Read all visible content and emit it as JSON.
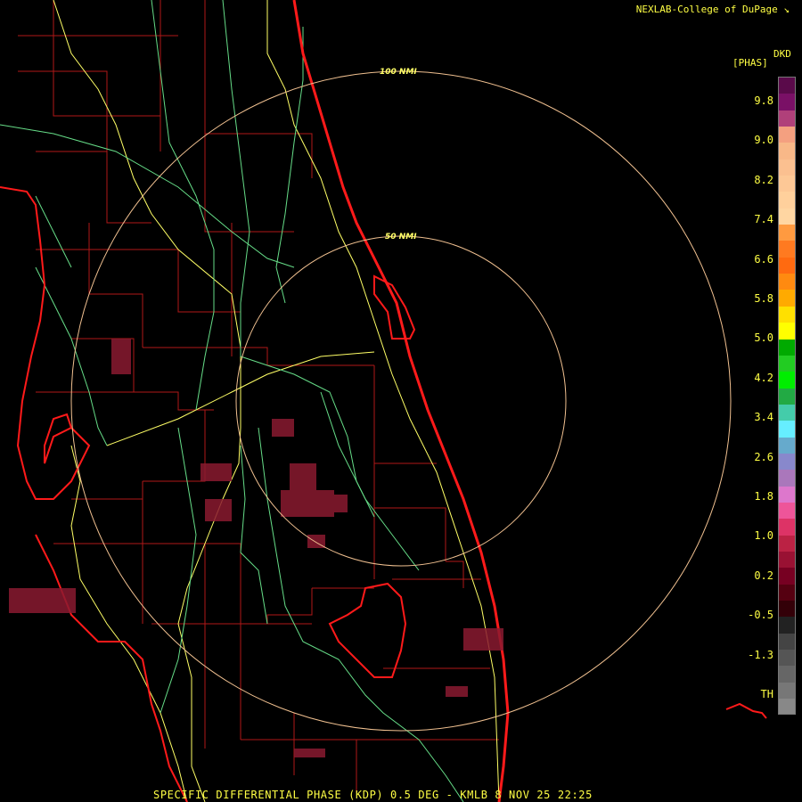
{
  "credit": "NEXLAB-College of DuPage",
  "credit_logo_icon": "nexlab-logo-icon",
  "footer": "SPECIFIC DIFFERENTIAL PHASE (KDP) 0.5 DEG - KMLB 8 NOV 25 22:25",
  "legend": {
    "unit_left": "[PHAS]",
    "unit_right": "DKD",
    "labels": [
      "9.8",
      "9.0",
      "8.2",
      "7.4",
      "6.6",
      "5.8",
      "5.0",
      "4.2",
      "3.4",
      "2.6",
      "1.8",
      "1.0",
      "0.2",
      "-0.5",
      "-1.3",
      "TH"
    ],
    "colors": [
      "#5a0a4a",
      "#7a1066",
      "#b0407a",
      "#f4a080",
      "#f8b888",
      "#fbc090",
      "#fdc896",
      "#ffd09c",
      "#ffd6a2",
      "#ff9a40",
      "#ff7a20",
      "#ff6a10",
      "#ff8a10",
      "#ffaa00",
      "#ffe000",
      "#ffff00",
      "#00aa00",
      "#22cc22",
      "#00ee00",
      "#22aa44",
      "#44ccaa",
      "#66eeff",
      "#66aacc",
      "#8888cc",
      "#aa77bb",
      "#dd77cc",
      "#ee5599",
      "#dd3366",
      "#bb2244",
      "#991133",
      "#770022",
      "#550011",
      "#330008",
      "#222222",
      "#444444",
      "#555555",
      "#666666",
      "#777777",
      "#888888"
    ]
  },
  "rings": [
    {
      "label": "50 NMI",
      "value_nmi": 50
    },
    {
      "label": "100 NMI",
      "value_nmi": 100
    }
  ],
  "radar_site": "KMLB",
  "product": "KDP",
  "elevation": "0.5 DEG",
  "colors": {
    "coastline": "#ff1a1a",
    "county": "#c01818",
    "highway_interstate": "#ffff66",
    "highway_other": "#66dd88",
    "ring": "#f0c090",
    "text": "#ffff44",
    "echo": "#8a1a30"
  }
}
